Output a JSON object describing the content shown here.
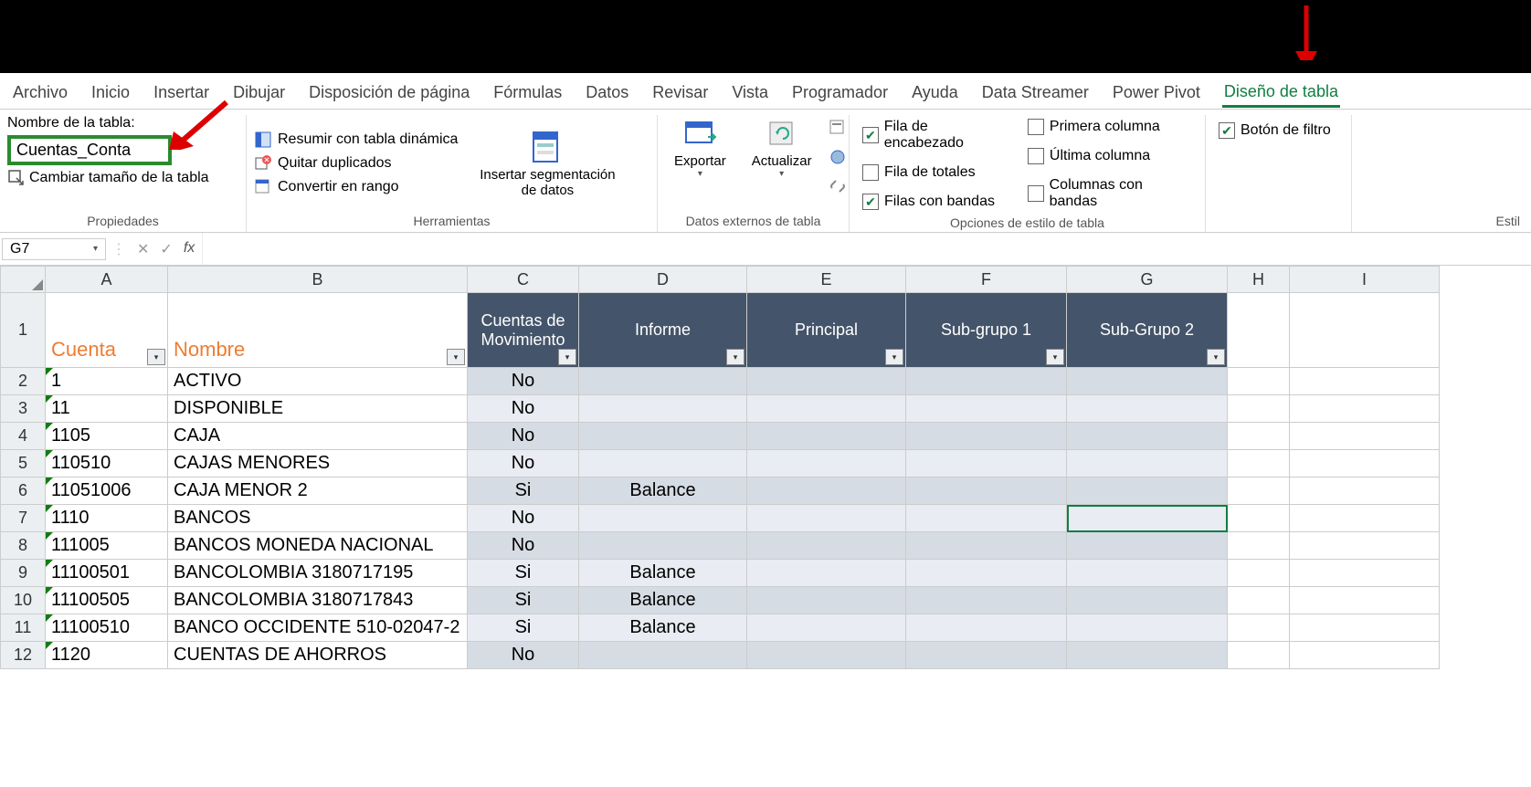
{
  "ribbonTabs": {
    "archivo": "Archivo",
    "inicio": "Inicio",
    "insertar": "Insertar",
    "dibujar": "Dibujar",
    "disposicion": "Disposición de página",
    "formulas": "Fórmulas",
    "datos": "Datos",
    "revisar": "Revisar",
    "vista": "Vista",
    "programador": "Programador",
    "ayuda": "Ayuda",
    "dataStreamer": "Data Streamer",
    "powerPivot": "Power Pivot",
    "disenoTabla": "Diseño de tabla"
  },
  "propertiesGroup": {
    "label": "Nombre de la tabla:",
    "tableName": "Cuentas_Conta",
    "resize": "Cambiar tamaño de la tabla",
    "groupLabel": "Propiedades"
  },
  "toolsGroup": {
    "summarize": "Resumir con tabla dinámica",
    "removeDup": "Quitar duplicados",
    "convertRange": "Convertir en rango",
    "insertSlicer": "Insertar segmentación de datos",
    "groupLabel": "Herramientas"
  },
  "externalGroup": {
    "export": "Exportar",
    "refresh": "Actualizar",
    "groupLabel": "Datos externos de tabla"
  },
  "styleOptions": {
    "headerRow": "Fila de encabezado",
    "totalRow": "Fila de totales",
    "bandedRows": "Filas con bandas",
    "firstCol": "Primera columna",
    "lastCol": "Última columna",
    "bandedCols": "Columnas con bandas",
    "filterBtn": "Botón de filtro",
    "groupLabel": "Opciones de estilo de tabla",
    "stylesLabel": "Estil"
  },
  "formulaBar": {
    "nameBox": "G7",
    "formula": ""
  },
  "columns": [
    "A",
    "B",
    "C",
    "D",
    "E",
    "F",
    "G",
    "H",
    "I"
  ],
  "tableHeaders": {
    "cuenta": "Cuenta",
    "nombre": "Nombre",
    "cuentasMovimiento": "Cuentas de Movimiento",
    "informe": "Informe",
    "principal": "Principal",
    "subgrupo1": "Sub-grupo 1",
    "subgrupo2": "Sub-Grupo 2"
  },
  "rows": [
    {
      "n": "1"
    },
    {
      "n": "2",
      "a": "1",
      "b": "ACTIVO",
      "c": "No",
      "d": "",
      "e": "",
      "f": "",
      "g": ""
    },
    {
      "n": "3",
      "a": "11",
      "b": "DISPONIBLE",
      "c": "No",
      "d": "",
      "e": "",
      "f": "",
      "g": ""
    },
    {
      "n": "4",
      "a": "1105",
      "b": "CAJA",
      "c": "No",
      "d": "",
      "e": "",
      "f": "",
      "g": ""
    },
    {
      "n": "5",
      "a": "110510",
      "b": "CAJAS MENORES",
      "c": "No",
      "d": "",
      "e": "",
      "f": "",
      "g": ""
    },
    {
      "n": "6",
      "a": "11051006",
      "b": "CAJA MENOR 2",
      "c": "Si",
      "d": "Balance",
      "e": "",
      "f": "",
      "g": ""
    },
    {
      "n": "7",
      "a": "1110",
      "b": "BANCOS",
      "c": "No",
      "d": "",
      "e": "",
      "f": "",
      "g": ""
    },
    {
      "n": "8",
      "a": "111005",
      "b": "BANCOS MONEDA NACIONAL",
      "c": "No",
      "d": "",
      "e": "",
      "f": "",
      "g": ""
    },
    {
      "n": "9",
      "a": "11100501",
      "b": "BANCOLOMBIA 3180717195",
      "c": "Si",
      "d": "Balance",
      "e": "",
      "f": "",
      "g": ""
    },
    {
      "n": "10",
      "a": "11100505",
      "b": "BANCOLOMBIA 3180717843",
      "c": "Si",
      "d": "Balance",
      "e": "",
      "f": "",
      "g": ""
    },
    {
      "n": "11",
      "a": "11100510",
      "b": "BANCO OCCIDENTE 510-02047-2",
      "c": "Si",
      "d": "Balance",
      "e": "",
      "f": "",
      "g": ""
    },
    {
      "n": "12",
      "a": "1120",
      "b": "CUENTAS DE AHORROS",
      "c": "No",
      "d": "",
      "e": "",
      "f": "",
      "g": ""
    }
  ]
}
